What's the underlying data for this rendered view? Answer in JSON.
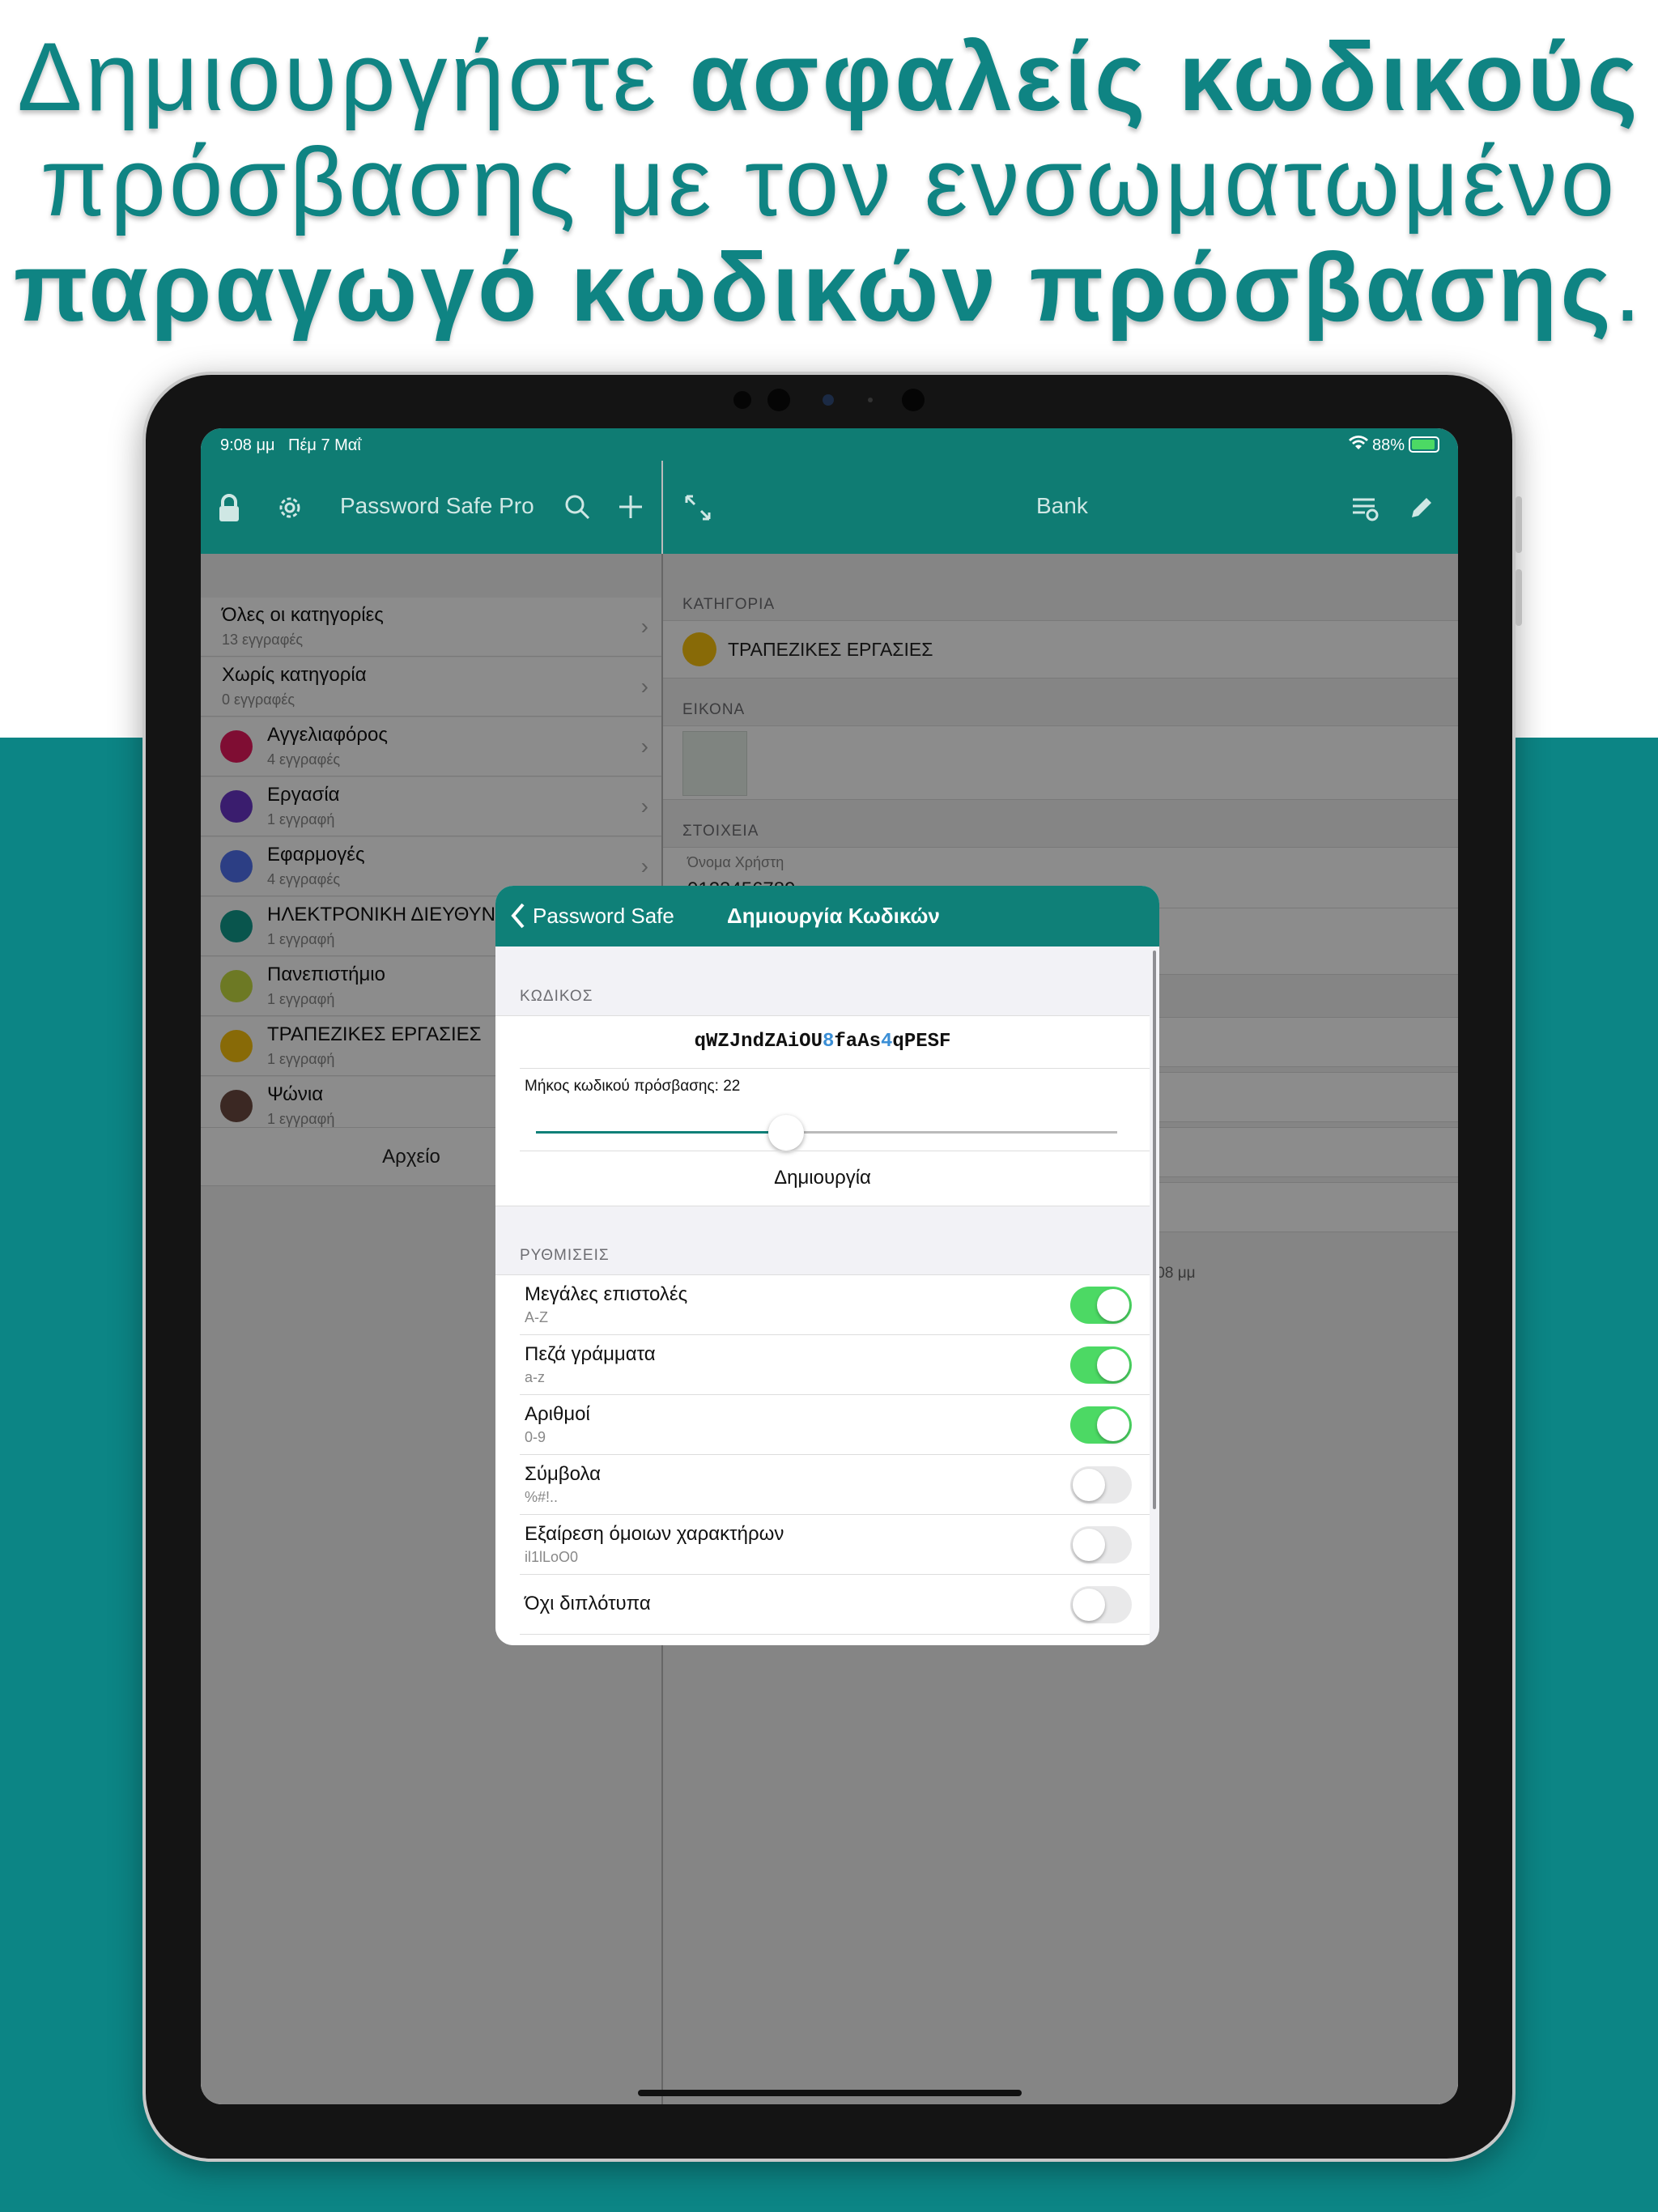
{
  "headline": {
    "line1_normal": "Δημιουργήστε ",
    "line1_bold": "ασφαλείς κωδικούς",
    "line2_normal": "πρόσβασης με τον ενσωματωμένο",
    "line3_bold": "παραγωγό κωδικών πρόσβασης",
    "line3_end": "."
  },
  "status": {
    "time": "9:08 μμ",
    "date": "Πέμ 7 Μαΐ",
    "battery": "88%"
  },
  "left_nav": {
    "title": "Password Safe Pro"
  },
  "right_nav": {
    "title": "Bank"
  },
  "categories": [
    {
      "label": "Όλες οι κατηγορίες",
      "count": "13 εγγραφές",
      "color": ""
    },
    {
      "label": "Χωρίς κατηγορία",
      "count": "0 εγγραφές",
      "color": ""
    },
    {
      "label": "Αγγελιαφόρος",
      "count": "4 εγγραφές",
      "color": "#e8185e"
    },
    {
      "label": "Εργασία",
      "count": "1 εγγραφή",
      "color": "#6a35c9"
    },
    {
      "label": "Εφαρμογές",
      "count": "4 εγγραφές",
      "color": "#5072f0"
    },
    {
      "label": "ΗΛΕΚΤΡΟΝΙΚΗ ΔΙΕΥΘΥΝΣΗ",
      "count": "1 εγγραφή",
      "color": "#129b8d"
    },
    {
      "label": "Πανεπιστήμιο",
      "count": "1 εγγραφή",
      "color": "#c7dc42"
    },
    {
      "label": "ΤΡΑΠΕΖΙΚΕΣ ΕΡΓΑΣΙΕΣ",
      "count": "1 εγγραφή",
      "color": "#f7c10d"
    },
    {
      "label": "Ψώνια",
      "count": "1 εγγραφή",
      "color": "#6c4a40"
    }
  ],
  "archive": "Αρχείο",
  "detail": {
    "category_header": "ΚΑΤΗΓΟΡΙΑ",
    "category_value": "ΤΡΑΠΕΖΙΚΕΣ ΕΡΓΑΣΙΕΣ",
    "category_color": "#f7c10d",
    "image_header": "ΕΙΚΟΝΑ",
    "details_header": "ΣΤΟΙΧΕΙΑ",
    "username_label": "Όνομα Χρήστη",
    "username_value": "0123456789",
    "modified_partial": ":08 μμ"
  },
  "generator": {
    "back_label": "Password Safe",
    "title": "Δημιουργία Κωδικών",
    "password_header": "ΚΩΔΙΚΟΣ",
    "password_parts": [
      "qWZJndZAiOU",
      "8",
      "faAs",
      "4",
      "qPESF"
    ],
    "length_label": "Μήκος κωδικού πρόσβασης: 22",
    "length_value": 22,
    "length_fraction": 0.43,
    "generate_label": "Δημιουργία",
    "settings_header": "ΡΥΘΜΙΣΕΙΣ",
    "settings": [
      {
        "title": "Μεγάλες επιστολές",
        "sub": "A-Z",
        "on": true
      },
      {
        "title": "Πεζά γράμματα",
        "sub": "a-z",
        "on": true
      },
      {
        "title": "Αριθμοί",
        "sub": "0-9",
        "on": true
      },
      {
        "title": "Σύμβολα",
        "sub": "%#!..",
        "on": false
      },
      {
        "title": "Εξαίρεση όμοιων χαρακτήρων",
        "sub": "il1lLoO0",
        "on": false
      },
      {
        "title": "Όχι διπλότυπα",
        "sub": "",
        "on": false
      }
    ]
  },
  "colors": {
    "teal": "#0f7c73",
    "headline": "#0f8483",
    "digit_blue": "#3b8fd6",
    "toggle_on": "#4cd964"
  }
}
